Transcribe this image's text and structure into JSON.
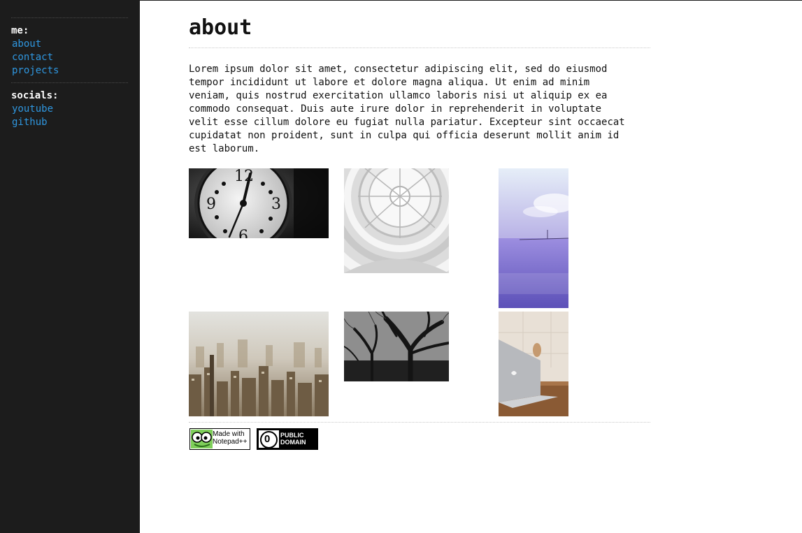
{
  "sidebar": {
    "me_heading": "me:",
    "me_links": [
      "about",
      "contact",
      "projects"
    ],
    "socials_heading": "socials:",
    "social_links": [
      "youtube",
      "github"
    ]
  },
  "main": {
    "title": "about",
    "body": "Lorem ipsum dolor sit amet, consectetur adipiscing elit, sed do eiusmod\ntempor incididunt ut labore et dolore magna aliqua. Ut enim ad minim\nveniam, quis nostrud exercitation ullamco laboris nisi ut aliquip ex ea\ncommodo consequat. Duis aute irure dolor in reprehenderit in voluptate\nvelit esse cillum dolore eu fugiat nulla pariatur. Excepteur sint occaecat\ncupidatat non proident, sunt in culpa qui officia deserunt mollit anim id\nest laborum."
  },
  "gallery": {
    "clock_numbers": [
      "12",
      "9",
      "3",
      "6"
    ]
  },
  "footer": {
    "notepad_badge_line1": "Made with",
    "notepad_badge_line2": "Notepad++",
    "public_domain_line1": "PUBLIC",
    "public_domain_line2": "DOMAIN",
    "public_domain_symbol": "0"
  },
  "colors": {
    "sidebar_bg": "#1c1c1c",
    "link": "#2f97e0",
    "heading": "#ffffff"
  }
}
